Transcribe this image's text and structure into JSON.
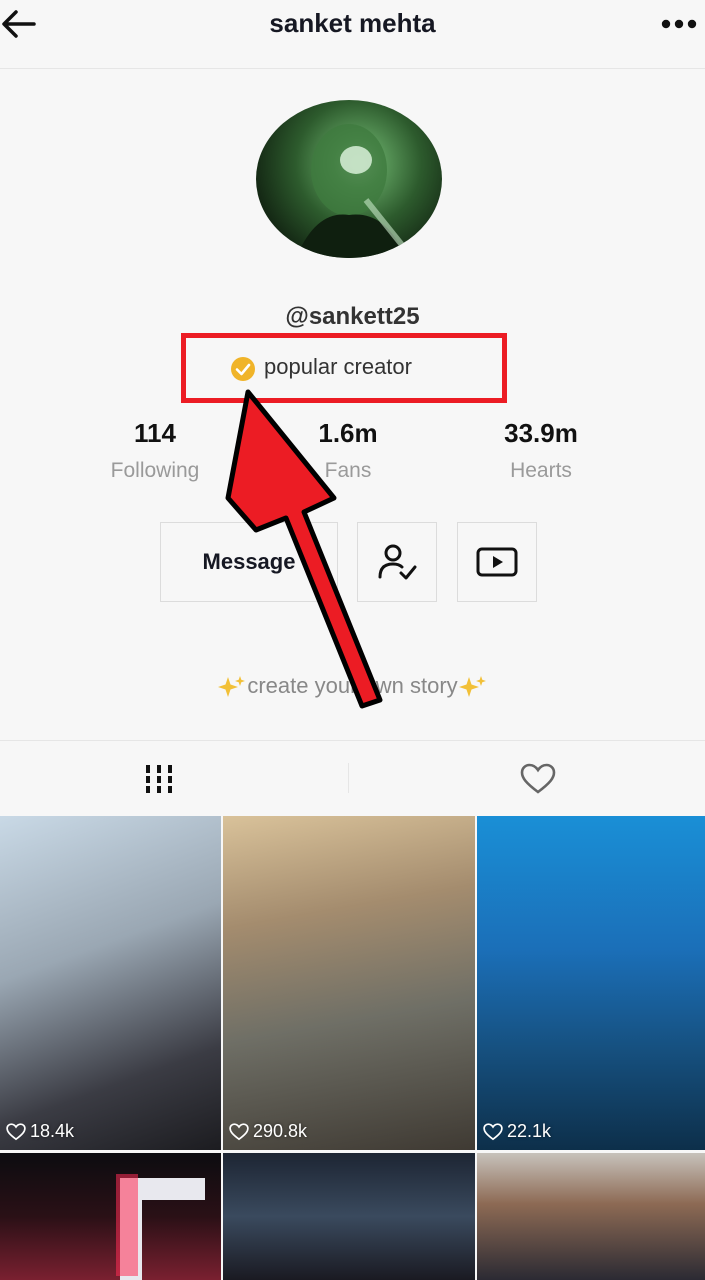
{
  "header": {
    "title": "sanket mehta",
    "back_icon": "arrow-left-icon",
    "more_icon": "ellipsis-icon"
  },
  "profile": {
    "handle": "@sankett25",
    "badge_label": "popular creator",
    "badge_icon": "verified-check-icon",
    "badge_color": "#f0b429",
    "bio": "create your own story",
    "bio_emoji": "sparkles",
    "stats": [
      {
        "value": "114",
        "label": "Following"
      },
      {
        "value": "1.6m",
        "label": "Fans"
      },
      {
        "value": "33.9m",
        "label": "Hearts"
      }
    ]
  },
  "actions": {
    "message_label": "Message",
    "follow_icon": "user-check-icon",
    "youtube_icon": "youtube-play-icon"
  },
  "tabs": [
    {
      "icon": "grid-icon",
      "active": true
    },
    {
      "icon": "heart-outline-icon",
      "active": false
    }
  ],
  "videos": [
    {
      "likes": "18.4k"
    },
    {
      "likes": "290.8k"
    },
    {
      "likes": "22.1k"
    },
    {
      "likes": ""
    },
    {
      "likes": ""
    },
    {
      "likes": ""
    }
  ],
  "annotation": {
    "box_color": "#ec1c24",
    "arrow_color": "#ec1c24"
  }
}
